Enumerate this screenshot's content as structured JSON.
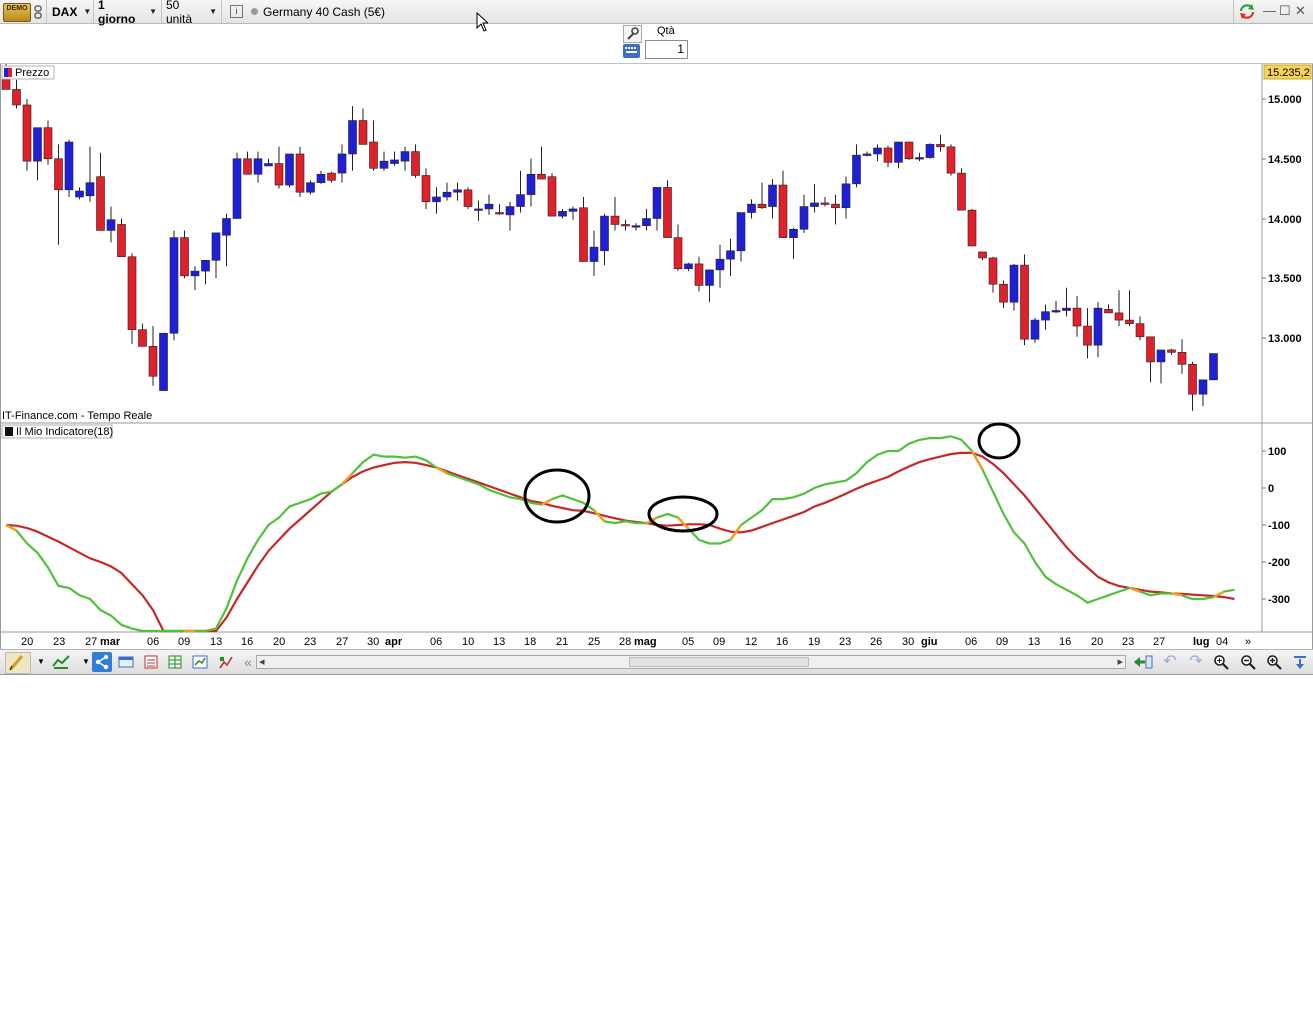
{
  "toolbar": {
    "demo_badge": "DEMO",
    "instrument": "DAX",
    "timeframe": "1 giorno",
    "units": "50 unità",
    "info_label": "i",
    "market_name": "Germany 40 Cash (5€)"
  },
  "order": {
    "qty_label": "Qtà",
    "qty_value": "1"
  },
  "price_panel": {
    "legend_label": "Prezzo",
    "source_label": "IT-Finance.com - Tempo Reale",
    "last_price_badge": "15.235,2",
    "y_ticks": [
      "15.000",
      "14.500",
      "14.000",
      "13.500",
      "13.000"
    ],
    "colors": {
      "up": "#1f1fd6",
      "down": "#e0202a",
      "badge": "#f6d35c"
    }
  },
  "indicator_panel": {
    "legend_label": "Il Mio Indicatore(18)",
    "y_ticks": [
      "100",
      "0",
      "-100",
      "-200",
      "-300"
    ],
    "colors": {
      "fast": "#4fc23a",
      "slow": "#c62828",
      "cross": "#f2a01c",
      "circle": "#000000"
    }
  },
  "x_axis": {
    "labels": [
      "20",
      "23",
      "27",
      "mar",
      "06",
      "09",
      "13",
      "16",
      "20",
      "23",
      "27",
      "30",
      "apr",
      "06",
      "10",
      "13",
      "18",
      "21",
      "25",
      "28",
      "mag",
      "05",
      "09",
      "12",
      "16",
      "19",
      "23",
      "26",
      "30",
      "giu",
      "06",
      "09",
      "13",
      "16",
      "20",
      "23",
      "27",
      "lug",
      "04"
    ],
    "scroll_arrow": "»"
  },
  "bottom_toolbar": {
    "collapse_arrow": "«",
    "scroll_left": "◂",
    "scroll_right": "▸"
  },
  "chart_data": {
    "type": "candlestick",
    "y_label_price": "",
    "ylim_price": [
      12400,
      15250
    ],
    "ylim_indicator": [
      -380,
      170
    ],
    "candles": [
      [
        15250,
        15300,
        15100,
        15080
      ],
      [
        15080,
        15160,
        14920,
        14950
      ],
      [
        14950,
        15000,
        14400,
        14480
      ],
      [
        14480,
        14760,
        14320,
        14760
      ],
      [
        14760,
        14820,
        14450,
        14500
      ],
      [
        14500,
        14620,
        13780,
        14240
      ],
      [
        14240,
        14660,
        14180,
        14640
      ],
      [
        14180,
        14260,
        14160,
        14230
      ],
      [
        14190,
        14600,
        14140,
        14300
      ],
      [
        14350,
        14550,
        14000,
        13900
      ],
      [
        13900,
        14100,
        13800,
        13990
      ],
      [
        13950,
        14000,
        13700,
        13680
      ],
      [
        13680,
        13710,
        12950,
        13070
      ],
      [
        13070,
        13120,
        12990,
        12930
      ],
      [
        12930,
        13100,
        12600,
        12680
      ],
      [
        12560,
        12860,
        12580,
        13040
      ],
      [
        13040,
        13900,
        12980,
        13840
      ],
      [
        13840,
        13900,
        13500,
        13520
      ],
      [
        13520,
        13600,
        13400,
        13560
      ],
      [
        13560,
        13650,
        13450,
        13650
      ],
      [
        13650,
        13700,
        13500,
        13880
      ],
      [
        13860,
        14040,
        13600,
        14000
      ],
      [
        14000,
        14550,
        14000,
        14500
      ],
      [
        14500,
        14560,
        14400,
        14370
      ],
      [
        14370,
        14560,
        14300,
        14500
      ],
      [
        14440,
        14500,
        14440,
        14460
      ],
      [
        14460,
        14600,
        14250,
        14280
      ],
      [
        14280,
        14540,
        14260,
        14540
      ],
      [
        14540,
        14600,
        14180,
        14220
      ],
      [
        14220,
        14320,
        14200,
        14300
      ],
      [
        14300,
        14400,
        14290,
        14370
      ],
      [
        14380,
        14390,
        14300,
        14320
      ],
      [
        14380,
        14620,
        14300,
        14540
      ],
      [
        14540,
        14940,
        14400,
        14820
      ],
      [
        14820,
        14920,
        14620,
        14620
      ],
      [
        14640,
        14820,
        14400,
        14420
      ],
      [
        14420,
        14560,
        14400,
        14480
      ],
      [
        14460,
        14560,
        14440,
        14490
      ],
      [
        14480,
        14600,
        14400,
        14560
      ],
      [
        14560,
        14620,
        14340,
        14360
      ],
      [
        14360,
        14420,
        14080,
        14140
      ],
      [
        14140,
        14260,
        14040,
        14180
      ],
      [
        14180,
        14300,
        14150,
        14220
      ],
      [
        14220,
        14300,
        14150,
        14240
      ],
      [
        14240,
        14260,
        14080,
        14100
      ],
      [
        14080,
        14150,
        13980,
        14080
      ],
      [
        14080,
        14200,
        14030,
        14120
      ],
      [
        14050,
        14120,
        14030,
        14040
      ],
      [
        14030,
        14140,
        13900,
        14100
      ],
      [
        14100,
        14400,
        14050,
        14200
      ],
      [
        14200,
        14500,
        14100,
        14370
      ],
      [
        14370,
        14600,
        14360,
        14330
      ],
      [
        14350,
        14380,
        14020,
        14020
      ],
      [
        14020,
        14080,
        14000,
        14060
      ],
      [
        14060,
        14100,
        13990,
        14080
      ],
      [
        14090,
        14180,
        13850,
        13640
      ],
      [
        13640,
        13900,
        13520,
        13760
      ],
      [
        13730,
        14040,
        13610,
        14020
      ],
      [
        14020,
        14180,
        13900,
        13950
      ],
      [
        13950,
        13990,
        13900,
        13940
      ],
      [
        13940,
        13960,
        13900,
        13940
      ],
      [
        13940,
        14080,
        13900,
        14000
      ],
      [
        14000,
        14160,
        13900,
        14260
      ],
      [
        14260,
        14320,
        13840,
        13840
      ],
      [
        13840,
        13950,
        13560,
        13580
      ],
      [
        13580,
        13630,
        13560,
        13620
      ],
      [
        13620,
        13680,
        13390,
        13440
      ],
      [
        13440,
        13560,
        13300,
        13570
      ],
      [
        13570,
        13780,
        13420,
        13660
      ],
      [
        13660,
        13830,
        13520,
        13730
      ],
      [
        13730,
        13860,
        13640,
        14050
      ],
      [
        14050,
        14160,
        14000,
        14120
      ],
      [
        14120,
        14300,
        14080,
        14090
      ],
      [
        14100,
        14330,
        14000,
        14280
      ],
      [
        14280,
        14400,
        13950,
        13840
      ],
      [
        13840,
        13920,
        13660,
        13910
      ],
      [
        13910,
        14200,
        13880,
        14100
      ],
      [
        14100,
        14290,
        14050,
        14130
      ],
      [
        14130,
        14180,
        14100,
        14120
      ],
      [
        14120,
        14200,
        13950,
        14090
      ],
      [
        14090,
        14350,
        14000,
        14290
      ],
      [
        14290,
        14620,
        14260,
        14530
      ],
      [
        14530,
        14560,
        14520,
        14540
      ],
      [
        14540,
        14620,
        14480,
        14590
      ],
      [
        14590,
        14610,
        14430,
        14470
      ],
      [
        14470,
        14640,
        14420,
        14640
      ],
      [
        14640,
        14640,
        14490,
        14500
      ],
      [
        14500,
        14550,
        14480,
        14510
      ],
      [
        14510,
        14630,
        14500,
        14620
      ],
      [
        14620,
        14700,
        14560,
        14600
      ],
      [
        14600,
        14620,
        14360,
        14380
      ],
      [
        14380,
        14420,
        14080,
        14070
      ],
      [
        14070,
        14080,
        13800,
        13770
      ],
      [
        13720,
        13720,
        13650,
        13670
      ],
      [
        13670,
        13680,
        13380,
        13450
      ],
      [
        13450,
        13480,
        13250,
        13300
      ],
      [
        13300,
        13620,
        13230,
        13610
      ],
      [
        13610,
        13700,
        12940,
        12990
      ],
      [
        12990,
        13170,
        12960,
        13150
      ],
      [
        13150,
        13280,
        13070,
        13220
      ],
      [
        13220,
        13310,
        13210,
        13230
      ],
      [
        13230,
        13420,
        13180,
        13250
      ],
      [
        13250,
        13350,
        13010,
        13100
      ],
      [
        13100,
        13250,
        12830,
        12940
      ],
      [
        12940,
        13300,
        12840,
        13250
      ],
      [
        13240,
        13280,
        13220,
        13210
      ],
      [
        13210,
        13400,
        13100,
        13150
      ],
      [
        13150,
        13400,
        13100,
        13120
      ],
      [
        13120,
        13180,
        12980,
        13010
      ],
      [
        13010,
        13010,
        12630,
        12800
      ],
      [
        12800,
        12900,
        12620,
        12900
      ],
      [
        12900,
        12910,
        12860,
        12880
      ],
      [
        12880,
        12990,
        12700,
        12780
      ],
      [
        12780,
        12800,
        12390,
        12530
      ],
      [
        12530,
        12650,
        12430,
        12650
      ],
      [
        12650,
        12870,
        12680,
        12870
      ]
    ],
    "series": [
      {
        "values": [
          -100,
          -115,
          -150,
          -175,
          -215,
          -265,
          -270,
          -290,
          -300,
          -330,
          -345,
          -370,
          -380,
          -400,
          -410,
          -420,
          -420,
          -420,
          -415,
          -405,
          -380,
          -325,
          -250,
          -190,
          -140,
          -100,
          -80,
          -50,
          -40,
          -30,
          -15,
          -10,
          10,
          40,
          70,
          90,
          85,
          85,
          82,
          85,
          75,
          55,
          40,
          30,
          20,
          10,
          -5,
          -15,
          -25,
          -30,
          -40,
          -45,
          -30,
          -20,
          -30,
          -40,
          -60,
          -90,
          -95,
          -90,
          -95,
          -95,
          -80,
          -70,
          -80,
          -110,
          -140,
          -150,
          -150,
          -140,
          -100,
          -80,
          -60,
          -30,
          -30,
          -25,
          -15,
          0,
          10,
          15,
          20,
          40,
          70,
          90,
          100,
          100,
          120,
          130,
          135,
          135,
          140,
          130,
          100,
          50,
          -10,
          -70,
          -120,
          -150,
          -200,
          -240,
          -260,
          -275,
          -290,
          -310,
          -300,
          -290,
          -280,
          -270,
          -280,
          -290,
          -285,
          -285,
          -290,
          -300,
          -300,
          -295,
          -280,
          -275
        ]
      },
      {
        "values": [
          -100,
          -102,
          -108,
          -118,
          -132,
          -145,
          -160,
          -175,
          -190,
          -200,
          -212,
          -230,
          -260,
          -290,
          -330,
          -390,
          -420,
          -420,
          -420,
          -410,
          -390,
          -350,
          -300,
          -255,
          -210,
          -170,
          -140,
          -110,
          -85,
          -60,
          -35,
          -10,
          10,
          30,
          45,
          55,
          62,
          68,
          70,
          68,
          62,
          55,
          45,
          35,
          25,
          15,
          5,
          -5,
          -15,
          -25,
          -35,
          -40,
          -48,
          -54,
          -60,
          -62,
          -68,
          -75,
          -82,
          -88,
          -92,
          -95,
          -100,
          -102,
          -100,
          -98,
          -98,
          -100,
          -110,
          -118,
          -120,
          -115,
          -105,
          -95,
          -85,
          -75,
          -65,
          -50,
          -40,
          -28,
          -15,
          -2,
          10,
          20,
          30,
          45,
          58,
          70,
          78,
          85,
          92,
          95,
          95,
          85,
          65,
          40,
          10,
          -20,
          -55,
          -90,
          -125,
          -160,
          -190,
          -215,
          -240,
          -255,
          -265,
          -270,
          -275,
          -280,
          -282,
          -285,
          -286,
          -288,
          -290,
          -292,
          -295,
          -300
        ]
      }
    ]
  }
}
